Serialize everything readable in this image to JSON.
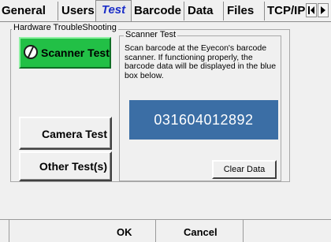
{
  "tabs": [
    {
      "label": "General"
    },
    {
      "label": "Users"
    },
    {
      "label": "Test"
    },
    {
      "label": "Barcode"
    },
    {
      "label": "Data"
    },
    {
      "label": "Files"
    },
    {
      "label": "TCP/IP"
    }
  ],
  "active_tab": "Test",
  "tab_scroll": {
    "left_icon": "first-page-icon",
    "right_icon": "next-page-icon"
  },
  "group": {
    "title": "Hardware TroubleShooting",
    "scanner_test_label": "Scanner Test",
    "camera_test_label": "Camera Test",
    "other_tests_label": "Other Test(s)"
  },
  "scanner_panel": {
    "title": "Scanner Test",
    "description": "Scan barcode at the Eyecon's barcode scanner. If functioning properly, the barcode data will be displayed in the blue box below.",
    "barcode_value": "031604012892",
    "clear_label": "Clear Data"
  },
  "footer": {
    "ok_label": "OK",
    "cancel_label": "Cancel"
  },
  "colors": {
    "active_tab_text": "#1c2fc8",
    "scanner_button": "#22c046",
    "barcode_box": "#3b6ea5"
  }
}
